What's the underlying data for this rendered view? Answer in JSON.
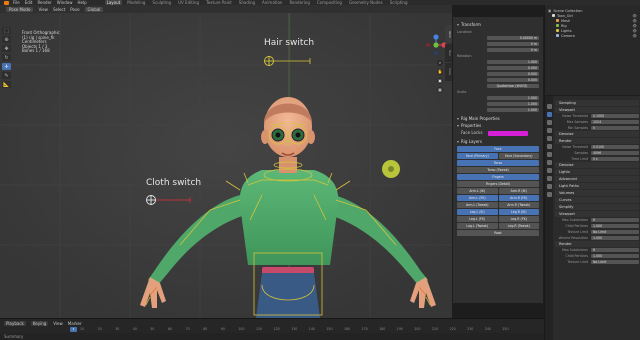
{
  "topbar": {
    "menus": [
      "File",
      "Edit",
      "Render",
      "Window",
      "Help"
    ],
    "workspaces": [
      "Layout",
      "Modeling",
      "Sculpting",
      "UV Editing",
      "Texture Paint",
      "Shading",
      "Animation",
      "Rendering",
      "Compositing",
      "Geometry Nodes",
      "Scripting"
    ],
    "active_workspace": "Layout"
  },
  "viewport": {
    "mode": "Pose Mode",
    "header_menus": [
      "View",
      "Select",
      "Pose"
    ],
    "orientation": "Global",
    "overlay_info": [
      "Front Orthographic",
      "(1) rig | spine_fk",
      "Centimeters",
      "",
      "Objects    1 / 3",
      "Bones      1 / 168"
    ],
    "hair_switch_label": "Hair switch",
    "cloth_switch_label": "Cloth switch",
    "tabs": [
      "Item",
      "Tool",
      "View"
    ],
    "active_tab": "Item"
  },
  "npanel": {
    "transform_title": "Transform",
    "location_label": "Location",
    "location": [
      "0.00000 m",
      "0 m",
      "0 m"
    ],
    "rotation_label": "Rotation",
    "rotation": [
      "1.000",
      "0.000",
      "0.000",
      "0.000"
    ],
    "rotation_mode": "Quaternion (WXYZ)",
    "scale_label": "Scale",
    "scale": [
      "1.000",
      "1.000",
      "1.000"
    ],
    "rig_main_title": "Rig Main Properties",
    "properties_title": "Properties",
    "face_lock_label": "Face Locks",
    "rig_layers_title": "Rig Layers",
    "rig_layers": [
      {
        "cells": [
          "Face"
        ],
        "on": [
          true
        ]
      },
      {
        "cells": [
          "Face (Primary)",
          "Face (Secondary)"
        ],
        "on": [
          true,
          false
        ]
      },
      {
        "cells": [
          "Torso"
        ],
        "on": [
          true
        ]
      },
      {
        "cells": [
          "Torso (Tweak)"
        ],
        "on": [
          false
        ]
      },
      {
        "cells": [
          "Fingers"
        ],
        "on": [
          true
        ]
      },
      {
        "cells": [
          "Fingers (Detail)"
        ],
        "on": [
          false
        ]
      },
      {
        "cells": [
          "Arm.L (IK)",
          "Arm.R (IK)"
        ],
        "on": [
          false,
          false
        ]
      },
      {
        "cells": [
          "Arm.L (FK)",
          "Arm.R (FK)"
        ],
        "on": [
          true,
          true
        ]
      },
      {
        "cells": [
          "Arm.L (Tweak)",
          "Arm.R (Tweak)"
        ],
        "on": [
          false,
          false
        ]
      },
      {
        "cells": [
          "Leg.L (IK)",
          "Leg.R (IK)"
        ],
        "on": [
          true,
          true
        ]
      },
      {
        "cells": [
          "Leg.L (FK)",
          "Leg.R (FK)"
        ],
        "on": [
          false,
          false
        ]
      },
      {
        "cells": [
          "Leg.L (Tweak)",
          "Leg.R (Tweak)"
        ],
        "on": [
          false,
          false
        ]
      },
      {
        "cells": [
          "Root"
        ],
        "on": [
          false
        ]
      }
    ]
  },
  "outliner": {
    "title": "Scene Collection",
    "items": [
      {
        "name": "Toon_Girl",
        "color": "#d8d8d8"
      },
      {
        "name": "Mesh",
        "color": "#e6a24a"
      },
      {
        "name": "Rig",
        "color": "#7fbf4a"
      },
      {
        "name": "Lights",
        "color": "#d8c24a"
      },
      {
        "name": "Camera",
        "color": "#9ab8e0"
      }
    ]
  },
  "properties": {
    "sections": [
      {
        "title": "Sampling",
        "rows": []
      },
      {
        "title": "Viewport",
        "rows": [
          [
            "Noise Threshold",
            "0.1000"
          ],
          [
            "Max Samples",
            "1024"
          ],
          [
            "Min Samples",
            "0"
          ]
        ]
      },
      {
        "title": "Denoise",
        "rows": []
      },
      {
        "title": "Render",
        "rows": [
          [
            "Noise Threshold",
            "0.0100"
          ],
          [
            "Samples",
            "4096"
          ],
          [
            "Time Limit",
            "0 s"
          ]
        ]
      },
      {
        "title": "Denoise",
        "rows": []
      },
      {
        "title": "Lights",
        "rows": []
      },
      {
        "title": "Advanced",
        "rows": []
      },
      {
        "title": "Light Paths",
        "rows": []
      },
      {
        "title": "Volumes",
        "rows": []
      },
      {
        "title": "Curves",
        "rows": []
      },
      {
        "title": "Simplify",
        "rows": []
      },
      {
        "title": "Viewport",
        "rows": [
          [
            "Max Subdivision",
            "6"
          ],
          [
            "Child Particles",
            "1.000"
          ],
          [
            "Texture Limit",
            "No Limit"
          ],
          [
            "Volume Resolution",
            "1.000"
          ]
        ]
      },
      {
        "title": "Render",
        "rows": [
          [
            "Max Subdivision",
            "6"
          ],
          [
            "Child Particles",
            "1.000"
          ],
          [
            "Texture Limit",
            "No Limit"
          ]
        ]
      }
    ]
  },
  "timeline": {
    "menus": [
      "Playback",
      "Keying",
      "View",
      "Marker"
    ],
    "current_frame": "1",
    "ticks": [
      "10",
      "20",
      "30",
      "40",
      "50",
      "60",
      "70",
      "80",
      "90",
      "100",
      "110",
      "120",
      "130",
      "140",
      "150",
      "160",
      "170",
      "180",
      "190",
      "200",
      "210",
      "220",
      "230",
      "240",
      "250"
    ],
    "status": "Summary"
  },
  "colors": {
    "accent": "#4772b3",
    "face_lock": "#d81fd8",
    "bone_yellow": "#d7c43a",
    "shirt": "#4fa86a"
  }
}
